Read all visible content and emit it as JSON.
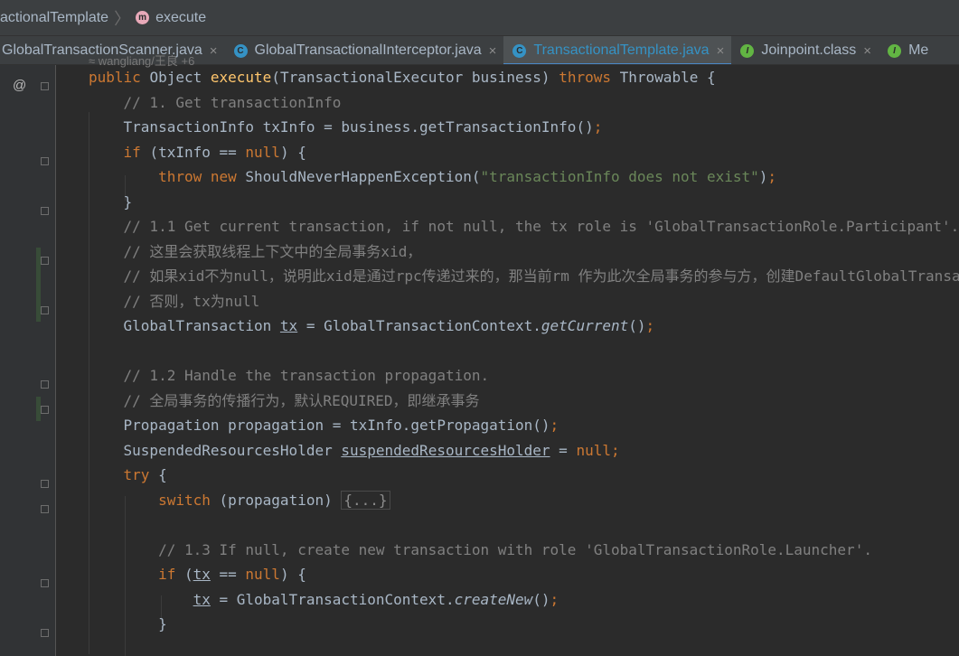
{
  "breadcrumb": {
    "class_name": "sactionalTemplate",
    "method_name": "execute",
    "method_icon_letter": "m"
  },
  "tabs": [
    {
      "label": "GlobalTransactionScanner.java",
      "icon": "none",
      "active": false
    },
    {
      "label": "GlobalTransactionalInterceptor.java",
      "icon": "class-icon",
      "icon_letter": "C",
      "active": false
    },
    {
      "label": "TransactionalTemplate.java",
      "icon": "class-icon",
      "icon_letter": "C",
      "active": true
    },
    {
      "label": "Joinpoint.class",
      "icon": "interface-icon",
      "icon_letter": "I",
      "active": false
    },
    {
      "label": "Me",
      "icon": "interface-icon",
      "icon_letter": "I",
      "active": false
    }
  ],
  "tab_close_glyph": "×",
  "editor": {
    "author_hint": "≈ wangliang/王良 +6",
    "annotation_glyph": "@",
    "lines": [
      [
        [
          "k",
          "public "
        ],
        [
          "",
          "Object "
        ],
        [
          "m",
          "execute"
        ],
        [
          "",
          "(TransactionalExecutor business) "
        ],
        [
          "k",
          "throws "
        ],
        [
          "",
          "Throwable {"
        ]
      ],
      [
        [
          "",
          "    "
        ],
        [
          "cm",
          "// 1. Get transactionInfo"
        ]
      ],
      [
        [
          "",
          "    TransactionInfo txInfo = business.getTransactionInfo()"
        ],
        [
          "k",
          ";"
        ]
      ],
      [
        [
          "",
          "    "
        ],
        [
          "k",
          "if "
        ],
        [
          "",
          "(txInfo == "
        ],
        [
          "k",
          "null"
        ],
        [
          "",
          ") {"
        ]
      ],
      [
        [
          "",
          "        "
        ],
        [
          "k",
          "throw new "
        ],
        [
          "",
          "ShouldNeverHappenException("
        ],
        [
          "s",
          "\"transactionInfo does not exist\""
        ],
        [
          "",
          ")"
        ],
        [
          "k",
          ";"
        ]
      ],
      [
        [
          "",
          "    }"
        ]
      ],
      [
        [
          "",
          "    "
        ],
        [
          "cm",
          "// 1.1 Get current transaction, if not null, the tx role is 'GlobalTransactionRole.Participant'."
        ]
      ],
      [
        [
          "",
          "    "
        ],
        [
          "cm",
          "// 这里会获取线程上下文中的全局事务xid，"
        ]
      ],
      [
        [
          "",
          "    "
        ],
        [
          "cm",
          "// 如果xid不为null，说明此xid是通过rpc传递过来的，那当前rm 作为此次全局事务的参与方，创建DefaultGlobalTransaction"
        ]
      ],
      [
        [
          "",
          "    "
        ],
        [
          "cm",
          "// 否则，tx为null"
        ]
      ],
      [
        [
          "",
          "    GlobalTransaction "
        ],
        [
          "u",
          "tx"
        ],
        [
          "",
          " = GlobalTransactionContext."
        ],
        [
          "i",
          "getCurrent"
        ],
        [
          "",
          "()"
        ],
        [
          "k",
          ";"
        ]
      ],
      [
        [
          "",
          ""
        ]
      ],
      [
        [
          "",
          "    "
        ],
        [
          "cm",
          "// 1.2 Handle the transaction propagation."
        ]
      ],
      [
        [
          "",
          "    "
        ],
        [
          "cm",
          "// 全局事务的传播行为，默认REQUIRED，即继承事务"
        ]
      ],
      [
        [
          "",
          "    Propagation propagation = txInfo.getPropagation()"
        ],
        [
          "k",
          ";"
        ]
      ],
      [
        [
          "",
          "    SuspendedResourcesHolder "
        ],
        [
          "u",
          "suspendedResourcesHolder"
        ],
        [
          "",
          " = "
        ],
        [
          "k",
          "null;"
        ]
      ],
      [
        [
          "",
          "    "
        ],
        [
          "k",
          "try "
        ],
        [
          "",
          "{"
        ]
      ],
      [
        [
          "",
          "        "
        ],
        [
          "k",
          "switch "
        ],
        [
          "",
          "(propagation) "
        ],
        [
          "fb",
          "{...}"
        ]
      ],
      [
        [
          "",
          ""
        ]
      ],
      [
        [
          "",
          "        "
        ],
        [
          "cm",
          "// 1.3 If null, create new transaction with role 'GlobalTransactionRole.Launcher'."
        ]
      ],
      [
        [
          "",
          "        "
        ],
        [
          "k",
          "if "
        ],
        [
          "",
          "("
        ],
        [
          "u",
          "tx"
        ],
        [
          "",
          " == "
        ],
        [
          "k",
          "null"
        ],
        [
          "",
          ") {"
        ]
      ],
      [
        [
          "",
          "            "
        ],
        [
          "u",
          "tx"
        ],
        [
          "",
          " = GlobalTransactionContext."
        ],
        [
          "i",
          "createNew"
        ],
        [
          "",
          "()"
        ],
        [
          "k",
          ";"
        ]
      ],
      [
        [
          "",
          "        }"
        ]
      ]
    ]
  }
}
